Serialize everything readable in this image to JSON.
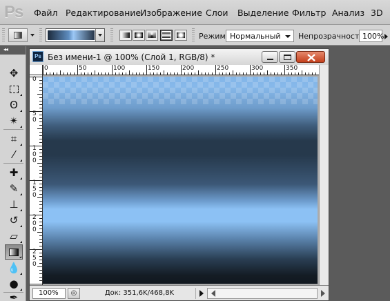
{
  "app": {
    "logo": "Ps"
  },
  "menu": [
    "Файл",
    "Редактирование",
    "Изображение",
    "Слои",
    "Выделение",
    "Фильтр",
    "Анализ",
    "3D"
  ],
  "options": {
    "mode_label": "Режим:",
    "mode_value": "Нормальный",
    "opacity_label": "Непрозрачность:",
    "opacity_value": "100%",
    "gradient_types": [
      "linear",
      "radial",
      "angle",
      "reflected",
      "diamond"
    ],
    "selected_gradient_type": "reflected"
  },
  "document": {
    "badge": "Ps",
    "title": "Без имени-1 @ 100% (Слой 1, RGB/8) *",
    "ruler_top_labels": [
      "0",
      "50",
      "100",
      "150",
      "200",
      "250",
      "300",
      "350"
    ],
    "ruler_left_labels": [
      "0",
      "50",
      "100",
      "150",
      "200",
      "250"
    ],
    "zoom": "100%",
    "doc_info": "Док: 351,6K/468,8K"
  },
  "tools": [
    "move-icon",
    "marquee-icon",
    "lasso-icon",
    "magic-wand-icon",
    "crop-icon",
    "eyedropper-icon",
    "healing-brush-icon",
    "brush-icon",
    "clone-stamp-icon",
    "history-brush-icon",
    "eraser-icon",
    "gradient-icon",
    "blur-icon",
    "dodge-icon",
    "pen-icon"
  ],
  "selected_tool": "gradient-icon",
  "colors": {
    "canvas_top": "#83b6e8",
    "canvas_dark": "#26394c",
    "canvas_light": "#8cc1f4",
    "canvas_bottom": "#11181f"
  }
}
